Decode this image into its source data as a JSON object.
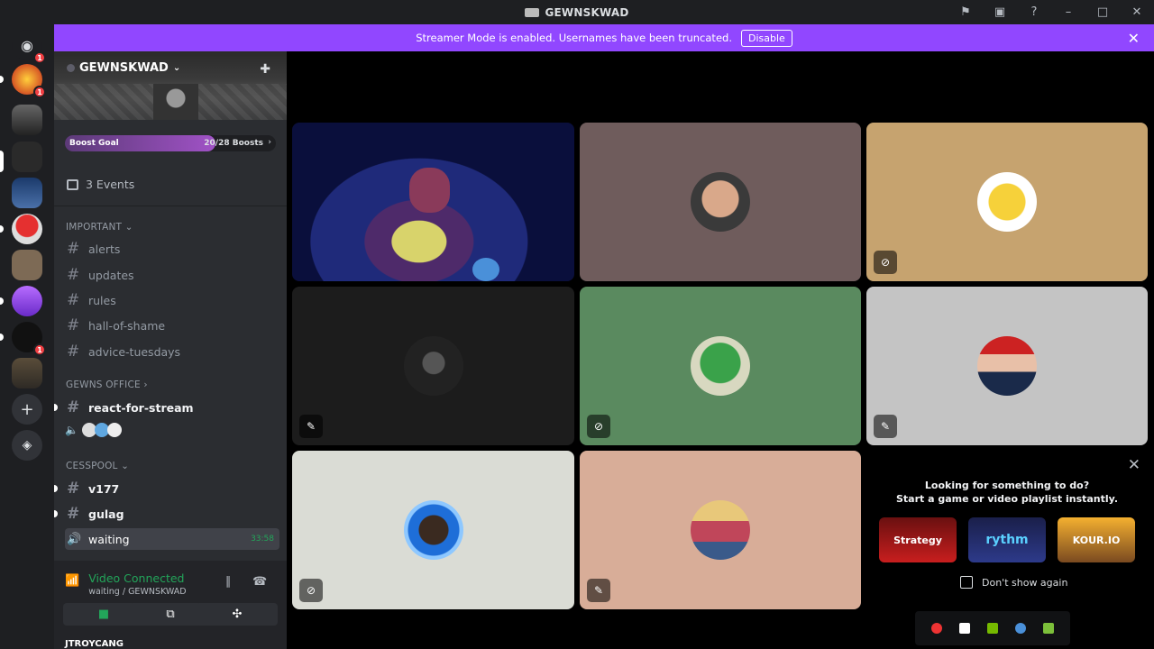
{
  "window": {
    "title": "GEWNSKWAD",
    "icons": [
      "flag-icon",
      "inbox-icon",
      "help-icon",
      "minimize-icon",
      "maximize-icon",
      "close-icon"
    ]
  },
  "streamer_banner": {
    "text": "Streamer Mode is enabled. Usernames have been truncated.",
    "disable_label": "Disable"
  },
  "guild_badges": {
    "g1": "1",
    "g2": "1",
    "g3": "1"
  },
  "server": {
    "name": "GEWNSKWAD",
    "boost_label": "Boost Goal",
    "boost_count": "20/28 Boosts",
    "boost_progress": 0.714,
    "events": "3 Events"
  },
  "categories": {
    "important": "IMPORTANT",
    "office": "GEWNS OFFICE",
    "cesspool": "CESSPOOL"
  },
  "channels": {
    "alerts": "alerts",
    "updates": "updates",
    "rules": "rules",
    "hall": "hall-of-shame",
    "advice": "advice-tuesdays",
    "react": "react-for-stream",
    "v177": "v177",
    "gulag": "gulag",
    "waiting": "waiting",
    "waiting_time": "33:58"
  },
  "voice_panel": {
    "status": "Video Connected",
    "location": "waiting / GEWNSKWAD",
    "user": "JTROYCANG"
  },
  "activity_prompt": {
    "line1": "Looking for something to do?",
    "line2": "Start a game or video playlist instantly.",
    "games": [
      "Strategy",
      "rythm",
      "KOUR.IO"
    ],
    "dont_show": "Don't show again"
  },
  "colors": {
    "accent": "#9147ff",
    "green": "#23a55a",
    "tile_brown": "#6f5c5c",
    "tile_tan": "#c6a36f",
    "tile_dark": "#1c1c1c",
    "tile_green": "#5a8a5f",
    "tile_gray": "#c4c4c4",
    "tile_light": "#dadcd5",
    "tile_peach": "#d8ad98"
  }
}
